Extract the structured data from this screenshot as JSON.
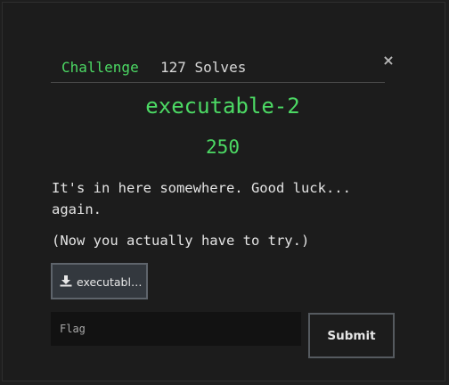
{
  "modal": {
    "close_glyph": "×",
    "tabs": {
      "challenge": "Challenge",
      "solves": "127 Solves"
    },
    "challenge_name": "executable-2",
    "points": "250",
    "description": "It's in here somewhere. Good luck...\nagain.",
    "note": "(Now you actually have to try.)",
    "file": {
      "label": "executable-2",
      "icon": "download-icon"
    },
    "flag_input": {
      "value": "",
      "placeholder": "Flag"
    },
    "submit_label": "Submit"
  },
  "colors": {
    "accent_green": "#4cd964",
    "background": "#1c1c1c",
    "input_background": "#121212",
    "file_button": "#33383e"
  }
}
